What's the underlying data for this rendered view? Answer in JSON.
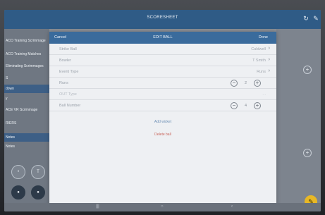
{
  "header": {
    "title": "SCORESHEET"
  },
  "sidebar": {
    "items": [
      "ACO Training Scrimmage",
      "ACO Training Matches",
      "Eliminating Scrimmages",
      "S",
      "down",
      "y",
      "ACE VR Scrimmage",
      "RIERS",
      "Notes",
      "Notes"
    ]
  },
  "modal": {
    "cancel_label": "Cancel",
    "title": "EDIT BALL",
    "done_label": "Done",
    "rows": [
      {
        "label": "Strike Ball",
        "value": "Caldwell",
        "chevron": true
      },
      {
        "label": "Bowler",
        "value": "T Smith",
        "chevron": true
      },
      {
        "label": "Event Type",
        "value": "Runs",
        "chevron": true
      },
      {
        "label": "Runs",
        "stepper_value": "2"
      },
      {
        "label": "OUT Type",
        "value": "..."
      },
      {
        "label": "Ball Number",
        "stepper_value": "4"
      }
    ],
    "add_label": "Add wicket",
    "delete_label": "Delete ball"
  },
  "colors": {
    "header_bar": "#2f5b86",
    "modal_header": "#3a6b9c",
    "fab": "#e8b826",
    "delete_text": "#c9665c"
  }
}
